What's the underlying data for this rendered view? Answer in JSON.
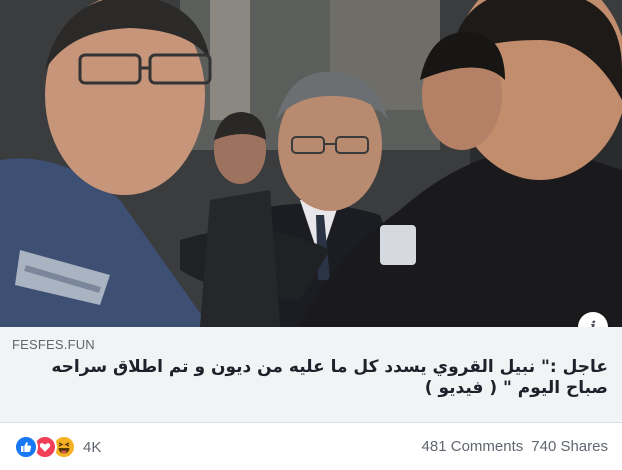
{
  "post": {
    "photo_alt": "Nabil Karoui surrounded by people",
    "info_glyph": "i",
    "domain": "FESFES.FUN",
    "headline": "عاجل :\" نبيل القروي يسدد كل ما عليه من ديون و تم اطلاق سراحه صباح اليوم \" ( فيديو )",
    "reactions": {
      "types": [
        "like-icon",
        "love-icon",
        "haha-icon"
      ],
      "count": "4K"
    },
    "comments": "481 Comments",
    "shares": "740 Shares"
  },
  "colors": {
    "like": "#1877f2",
    "love": "#f33e58",
    "haha": "#f7b125",
    "link_bg": "#f2f3f5",
    "meta_text": "#606770"
  }
}
